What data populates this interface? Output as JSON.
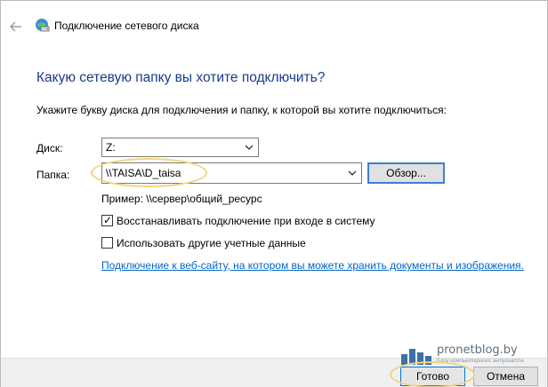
{
  "window": {
    "title": "Подключение сетевого диска"
  },
  "main": {
    "heading": "Какую сетевую папку вы хотите подключить?",
    "instruction": "Укажите букву диска для подключения и папку, к которой вы хотите подключиться:",
    "drive_label": "Диск:",
    "drive_value": "Z:",
    "folder_label": "Папка:",
    "folder_value": "\\\\TAISA\\D_taisa",
    "browse_label": "Обзор...",
    "example_text": "Пример: \\\\сервер\\общий_ресурс",
    "reconnect_label": "Восстанавливать подключение при входе в систему",
    "reconnect_checked": true,
    "credentials_label": "Использовать другие учетные данные",
    "credentials_checked": false,
    "website_link": "Подключение к веб-сайту, на котором вы можете хранить документы и изображения."
  },
  "footer": {
    "done_label": "Готово",
    "cancel_label": "Отмена"
  },
  "watermark": {
    "site": "pronetblog.by",
    "tagline": "Блог компьютерного энтузиаста"
  },
  "colors": {
    "heading": "#1a3a8c",
    "link": "#0066cc",
    "focus_border": "#3c7fd2",
    "highlight": "#f2d47a"
  },
  "icons": {
    "back": "back-arrow-icon",
    "wizard": "network-drive-icon",
    "chevron": "chevron-down-icon"
  }
}
